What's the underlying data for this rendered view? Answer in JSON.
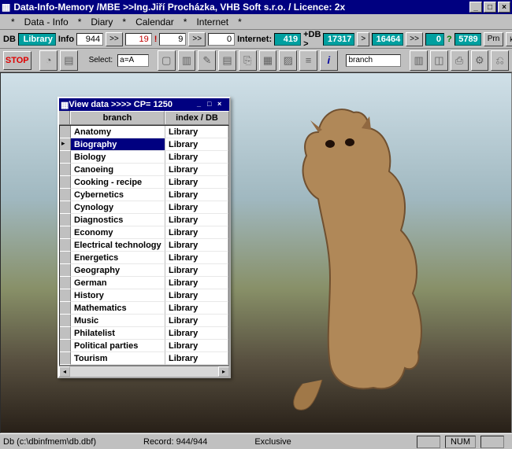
{
  "window": {
    "title": "Data-Info-Memory /MBE >>Ing.Jiří Procházka, VHB Soft s.r.o. / Licence: 2x"
  },
  "menu": {
    "items": [
      "Data - Info",
      "Diary",
      "Calendar",
      "Internet"
    ]
  },
  "toolbar1": {
    "db_label": "DB",
    "db_value": "Library",
    "info_label": "Info",
    "info_value": "944",
    "nav1": ">>",
    "info_count": "19",
    "bang": "!",
    "bang_a": "9",
    "nav2": ">>",
    "bang_b": "0",
    "internet_label": "Internet:",
    "internet_a": "419",
    "db2_label": "+DB >",
    "db2_a": "17317",
    "gt": ">",
    "db2_b": "16464",
    "nav3": ">>",
    "zero": "0",
    "q": "?",
    "qv": "5789",
    "prn": "Prn",
    "komplet": "komplet"
  },
  "toolbar2": {
    "stop": "STOP",
    "select_label": "Select:",
    "select_value": "a=A",
    "branch_label": "branch",
    "branch_value": ""
  },
  "child": {
    "title": "View data   >>>>  CP=   1250",
    "col1": "branch",
    "col2": "index / DB",
    "rows": [
      {
        "b": "Anatomy",
        "i": "Library"
      },
      {
        "b": "Biography",
        "i": "Library"
      },
      {
        "b": "Biology",
        "i": "Library"
      },
      {
        "b": "Canoeing",
        "i": "Library"
      },
      {
        "b": "Cooking - recipe",
        "i": "Library"
      },
      {
        "b": "Cybernetics",
        "i": "Library"
      },
      {
        "b": "Cynology",
        "i": "Library"
      },
      {
        "b": "Diagnostics",
        "i": "Library"
      },
      {
        "b": "Economy",
        "i": "Library"
      },
      {
        "b": "Electrical technology",
        "i": "Library"
      },
      {
        "b": "Energetics",
        "i": "Library"
      },
      {
        "b": "Geography",
        "i": "Library"
      },
      {
        "b": "German",
        "i": "Library"
      },
      {
        "b": "History",
        "i": "Library"
      },
      {
        "b": "Mathematics",
        "i": "Library"
      },
      {
        "b": "Music",
        "i": "Library"
      },
      {
        "b": "Philatelist",
        "i": "Library"
      },
      {
        "b": "Political parties",
        "i": "Library"
      },
      {
        "b": "Tourism",
        "i": "Library"
      }
    ],
    "selected_index": 1
  },
  "status": {
    "db_path": "Db (c:\\dbinfmem\\db.dbf)",
    "record": "Record: 944/944",
    "mode": "Exclusive",
    "num": "NUM"
  }
}
